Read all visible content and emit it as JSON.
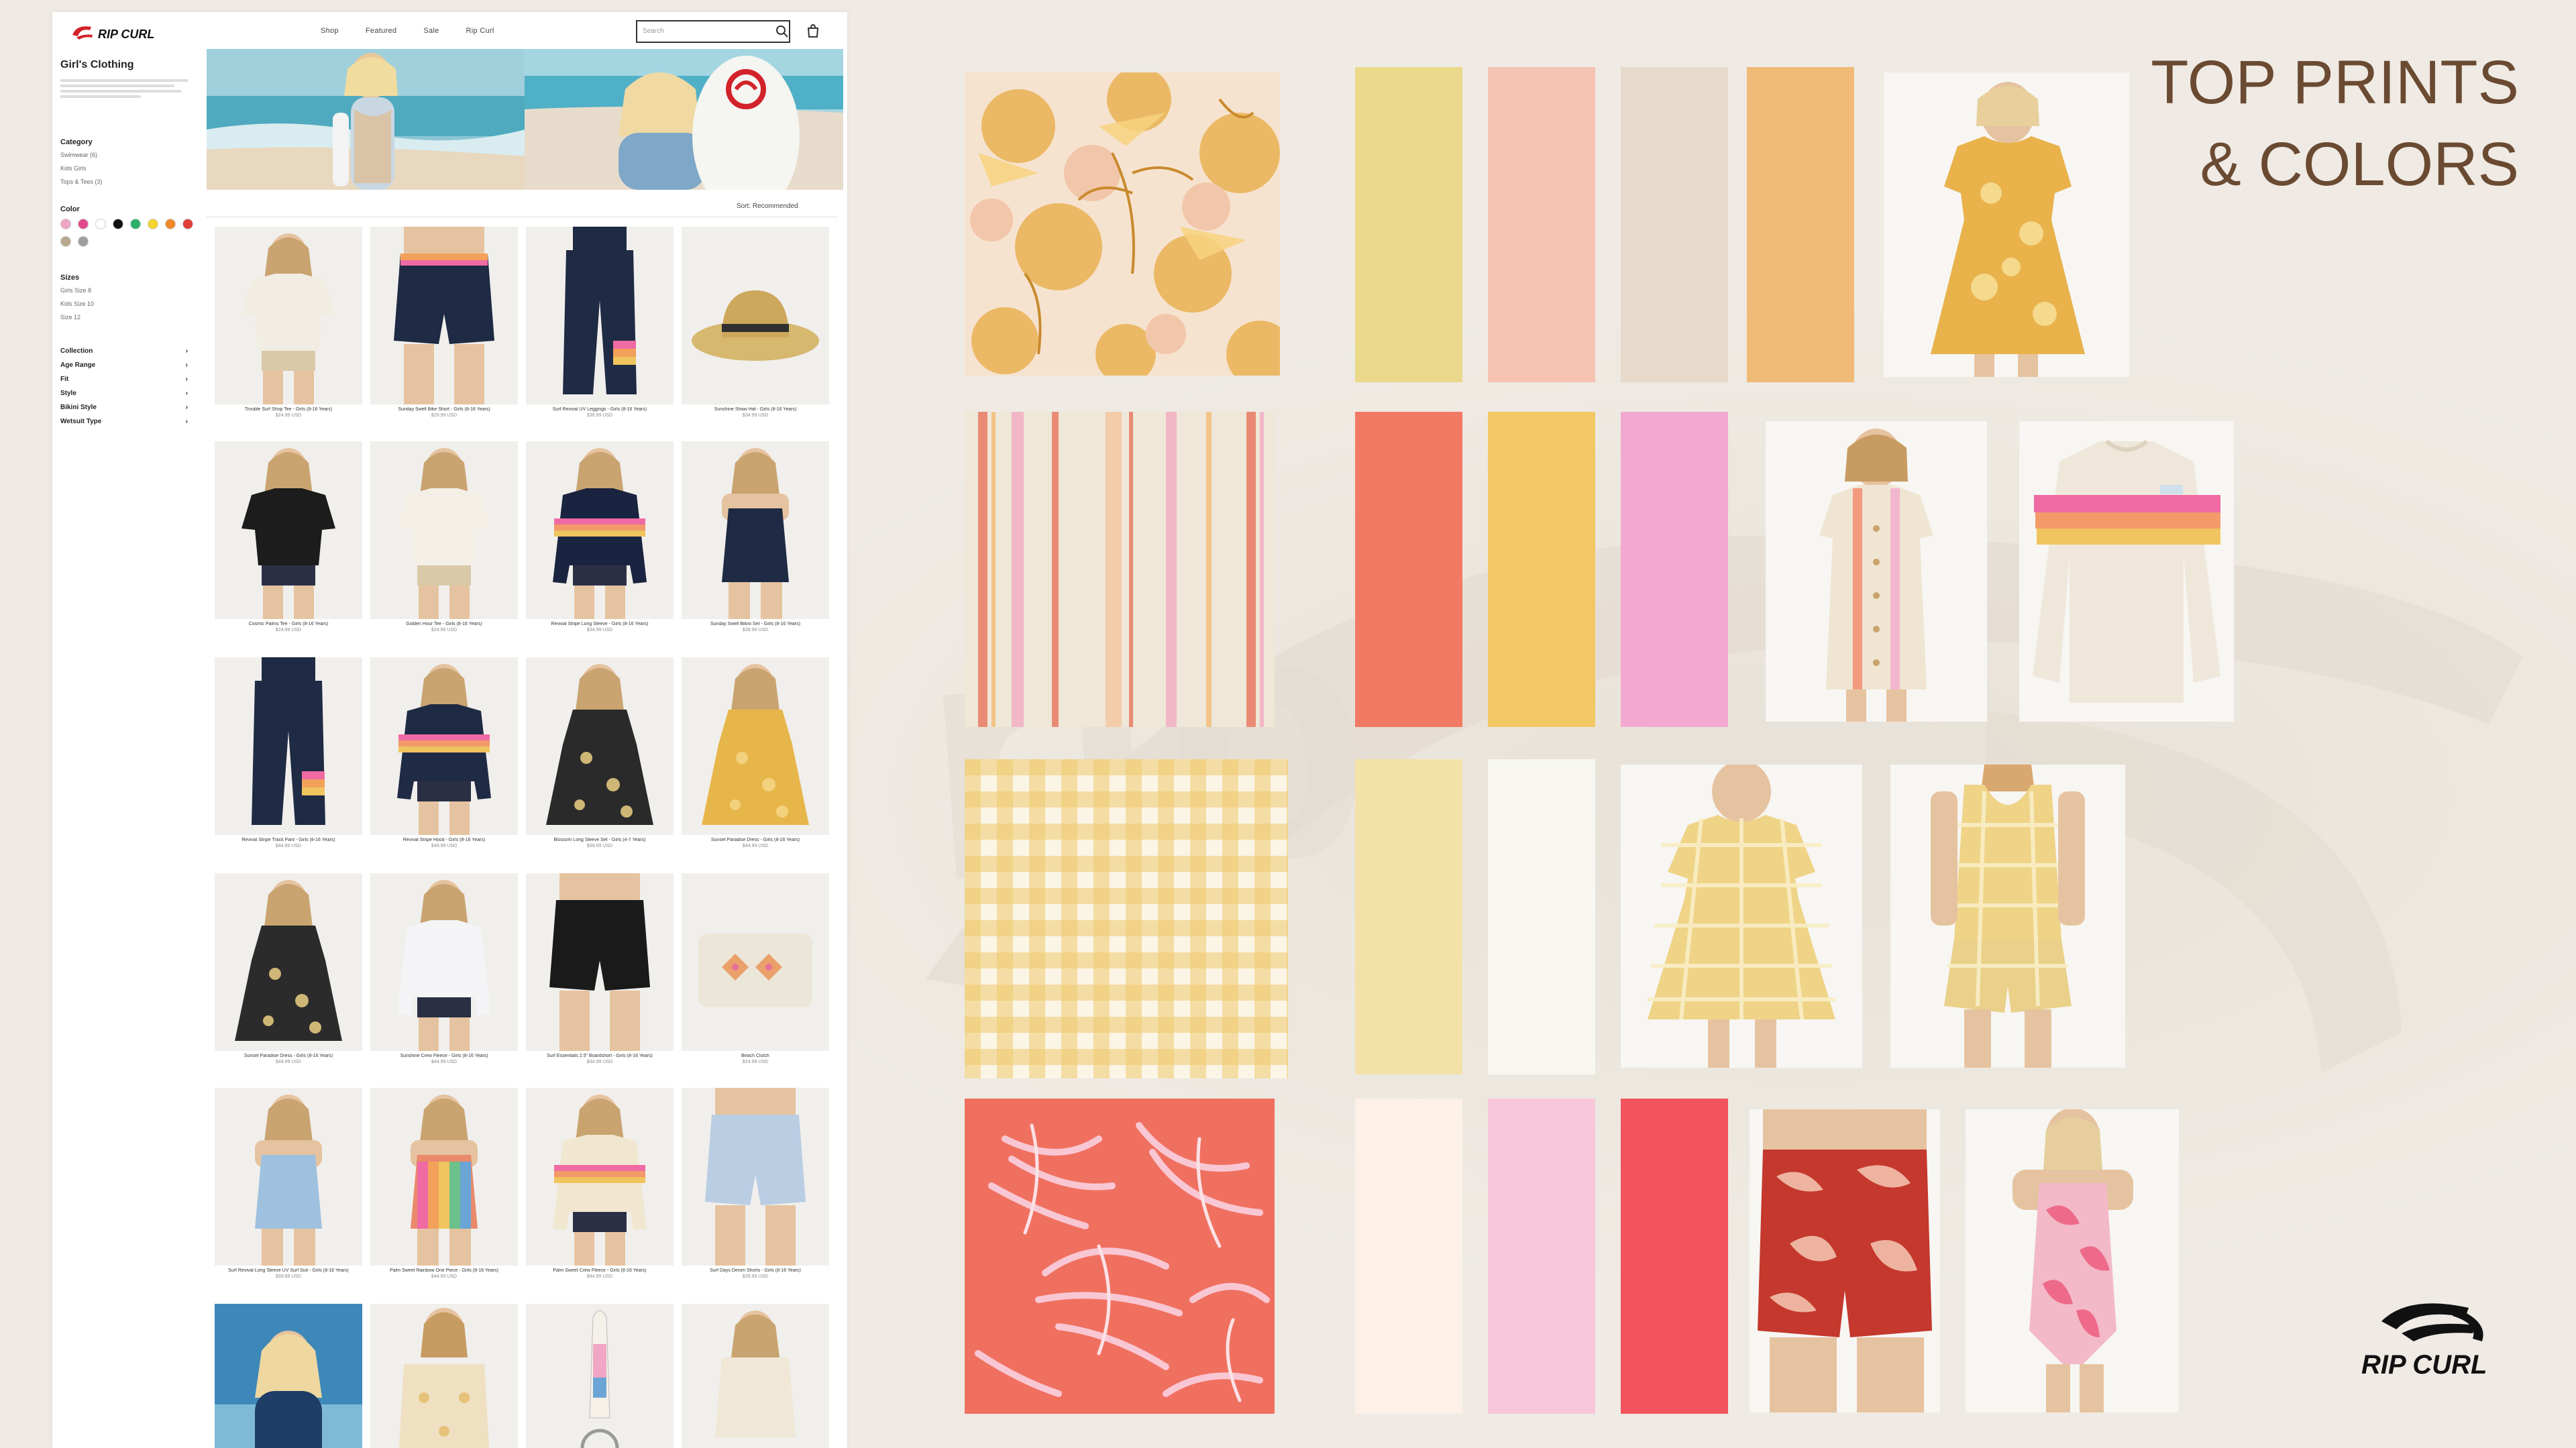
{
  "board": {
    "title_line1": "TOP PRINTS",
    "title_line2": "& COLORS",
    "brand": "RIP CURL",
    "title_color": "#6b4a32",
    "background_color": "#efebe4"
  },
  "site": {
    "logo_text": "RIP CURL",
    "nav": [
      "Shop",
      "Featured",
      "Sale",
      "Rip Curl"
    ],
    "search_placeholder": "Search",
    "page_title": "Girl's Clothing",
    "sort_label": "Sort: Recommended",
    "filters": {
      "category_title": "Category",
      "category_options": [
        "Swimwear (6)",
        "Kids Girls",
        "Tops & Tees (3)"
      ],
      "color_title": "Color",
      "color_swatches": [
        "#f0a6c4",
        "#e04a8a",
        "#ffffff",
        "#111111",
        "#2db06b",
        "#f5d431",
        "#f08a2a",
        "#e23b3b",
        "#b8a98e",
        "#9e9e9e"
      ],
      "size_title": "Sizes",
      "size_options": [
        "Girls Size 8",
        "Kids Size 10",
        "Size 12"
      ],
      "accordion": [
        "Collection",
        "Age Range",
        "Fit",
        "Style",
        "Bikini Style",
        "Wetsuit Type"
      ]
    },
    "products": [
      {
        "name": "Trouble Surf Shop Tee - Girls (8-16 Years)",
        "price": "$24.99 USD",
        "kind": "tee-cream",
        "color": "#f2ede2"
      },
      {
        "name": "Sunday Swell Bike Short - Girls (8-16 Years)",
        "price": "$29.99 USD",
        "kind": "shorts-navy",
        "color": "#1f2a44"
      },
      {
        "name": "Surf Revival UV Leggings - Girls (8-16 Years)",
        "price": "$39.99 USD",
        "kind": "legging-navy",
        "color": "#1f2a44"
      },
      {
        "name": "Sunshine Straw Hat - Girls (8-16 Years)",
        "price": "$34.99 USD",
        "kind": "hat-straw",
        "color": "#d6b86e"
      },
      {
        "name": "Cosmic Palms Tee - Girls (8-16 Years)",
        "price": "$24.99 USD",
        "kind": "tee-black",
        "color": "#1c1c1c"
      },
      {
        "name": "Golden Hour Tee - Girls (8-16 Years)",
        "price": "$24.99 USD",
        "kind": "tee-cream",
        "color": "#f4efe6"
      },
      {
        "name": "Revival Stripe Long Sleeve - Girls (8-16 Years)",
        "price": "$34.99 USD",
        "kind": "longsleeve-navy",
        "color": "#1a2440"
      },
      {
        "name": "Sunday Swell Bikini Set - Girls (8-16 Years)",
        "price": "$39.99 USD",
        "kind": "bikini-navy",
        "color": "#1f2a44"
      },
      {
        "name": "Revival Stripe Track Pant - Girls (8-16 Years)",
        "price": "$44.99 USD",
        "kind": "pant-navy",
        "color": "#1f2a44"
      },
      {
        "name": "Revival Stripe Hood - Girls (8-16 Years)",
        "price": "$49.99 USD",
        "kind": "hood-navy",
        "color": "#1f2a44"
      },
      {
        "name": "Blossom Long Sleeve Set - Girls (4-7 Years)",
        "price": "$39.99 USD",
        "kind": "kid-set",
        "color": "#2a2a2a"
      },
      {
        "name": "Sunset Paradise Dress - Girls (8-16 Years)",
        "price": "$44.99 USD",
        "kind": "dress-yellow",
        "color": "#e7b64a"
      },
      {
        "name": "Sunset Paradise Dress - Girls (8-16 Years)",
        "price": "$44.99 USD",
        "kind": "dress-black",
        "color": "#2b2b2b"
      },
      {
        "name": "Sunshine Crew Fleece - Girls (8-16 Years)",
        "price": "$44.99 USD",
        "kind": "crew-white",
        "color": "#f4f4f6"
      },
      {
        "name": "Surf Essentials 2.5\" Boardshort - Girls (8-16 Years)",
        "price": "$34.99 USD",
        "kind": "boardshort-black",
        "color": "#1a1a1a"
      },
      {
        "name": "Beach Clutch",
        "price": "$24.99 USD",
        "kind": "bag",
        "color": "#ece6d8"
      },
      {
        "name": "Surf Revival Long Sleeve UV Surf Suit - Girls (8-16 Years)",
        "price": "$59.99 USD",
        "kind": "surfsuit-print",
        "color": "#9fc0de"
      },
      {
        "name": "Palm Sweet Rainbow One Piece - Girls (8-16 Years)",
        "price": "$44.99 USD",
        "kind": "onepiece-rainbow",
        "color": "#e98a6a"
      },
      {
        "name": "Palm Sweet Crew Fleece - Girls (8-16 Years)",
        "price": "$44.99 USD",
        "kind": "crew-stripe",
        "color": "#f1e7d1"
      },
      {
        "name": "Surf Days Denim Shorts - Girls (8-16 Years)",
        "price": "$29.99 USD",
        "kind": "denim",
        "color": "#b9cde3"
      },
      {
        "name": "",
        "price": "",
        "kind": "wetsuit-photo",
        "color": "#2e6f9f"
      },
      {
        "name": "",
        "price": "",
        "kind": "crochet",
        "color": "#efe0c2"
      },
      {
        "name": "",
        "price": "",
        "kind": "keyring",
        "color": "#e9e4dc"
      },
      {
        "name": "",
        "price": "",
        "kind": "shirt-stripe",
        "color": "#f0e7d6"
      }
    ]
  },
  "rows": [
    {
      "print": "floral",
      "colors": [
        "#ead98a",
        "#f6c3b3",
        "#e7dacb",
        "#f0ba77"
      ],
      "products": [
        "Yellow floral tiered dress"
      ]
    },
    {
      "print": "stripe",
      "colors": [
        "#f27a64",
        "#f2c764",
        "#f3a8d0"
      ],
      "products": [
        "Striped button dress",
        "Cream sweatshirt with stripes"
      ]
    },
    {
      "print": "gingham",
      "colors": [
        "#f3e1a9",
        "#f7f6f1"
      ],
      "products": [
        "Gingham tiered dress",
        "Gingham cami and shorts set"
      ]
    },
    {
      "print": "tropical-palm",
      "colors": [
        "#fdf0e6",
        "#f7c7d9",
        "#f1545d"
      ],
      "products": [
        "Red palm print shorts",
        "Pink palm print one piece swimsuit"
      ]
    }
  ]
}
